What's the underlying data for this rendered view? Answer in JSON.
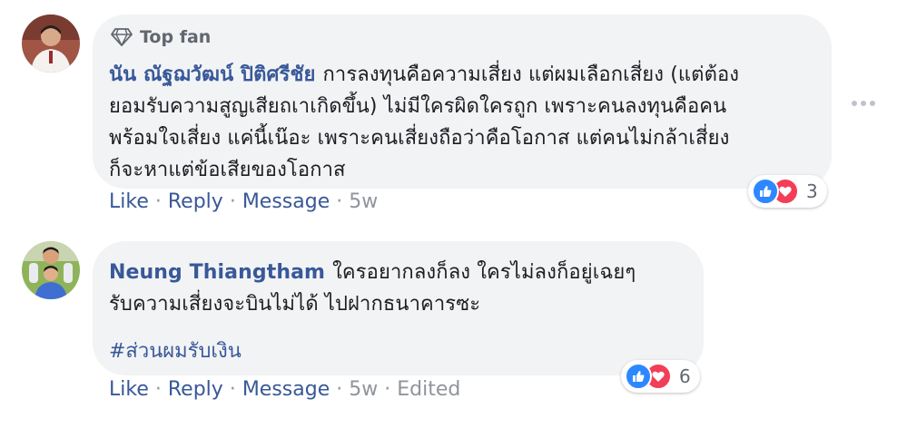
{
  "comments": [
    {
      "badge": "Top fan",
      "author": "นัน ณัฐฌวัฒน์ ปิติศรีชัย",
      "text": "การลงทุนคือความเสี่ยง แต่ผมเลือกเสี่ยง (แต่ต้อง\nยอมรับความสูญเสียถเาเกิดขึ้น) ไม่มีใครผิดใครถูก เพราะคนลงทุนคือคน\nพร้อมใจเสี่ยง แค่นี้เน๊อะ เพราะคนเสี่ยงถือว่าคือโอกาส แต่คนไม่กล้าเสี่ยง\nก็จะหาแต่ข้อเสียของโอกาส",
      "actions": {
        "like": "Like",
        "reply": "Reply",
        "message": "Message",
        "time": "5w"
      },
      "reaction_count": "3"
    },
    {
      "author": "Neung Thiangtham",
      "text": "ใครอยากลงก็ลง ใครไม่ลงก็อยู่เฉยๆ\nรับความเสี่ยงจะบินไม่ได้ ไปฝากธนาคารซะ",
      "hashtag": "#ส่วนผมรับเงิน",
      "actions": {
        "like": "Like",
        "reply": "Reply",
        "message": "Message",
        "time": "5w",
        "edited": "Edited"
      },
      "reaction_count": "6"
    }
  ],
  "colors": {
    "link": "#385898",
    "bubble": "#f2f3f5",
    "like": "#2d88ff",
    "love": "#f33e58"
  },
  "icons": {
    "badge": "diamond-icon",
    "like": "thumbs-up-icon",
    "love": "heart-icon",
    "more": "more-horizontal-icon"
  }
}
